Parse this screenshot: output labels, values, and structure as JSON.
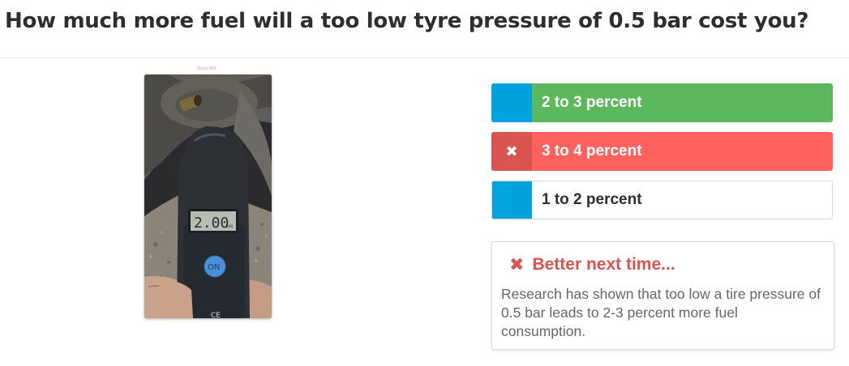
{
  "question": {
    "title": "How much more fuel will a too low tyre pressure of 0.5 bar cost you?"
  },
  "image": {
    "caption": "iStock 842",
    "gauge_reading": "2.00",
    "gauge_unit": "BAR",
    "gauge_button": "ON",
    "gauge_mark": "CE"
  },
  "answers": [
    {
      "label": "2 to 3 percent",
      "state": "correct",
      "marker_icon": ""
    },
    {
      "label": "3 to 4 percent",
      "state": "wrong-selected",
      "marker_icon": "✖"
    },
    {
      "label": "1 to 2 percent",
      "state": "neutral",
      "marker_icon": ""
    }
  ],
  "feedback": {
    "icon": "✖",
    "heading": "Better next time...",
    "text": "Research has shown that too low a tire pressure of 0.5 bar leads to 2-3 percent more fuel consumption."
  },
  "colors": {
    "correct": "#5cb85c",
    "wrong": "#ff625e",
    "wrong_marker": "#d9534f",
    "marker": "#00a3e0",
    "title": "#2e2e2e",
    "feedback_heading": "#d9534f"
  }
}
